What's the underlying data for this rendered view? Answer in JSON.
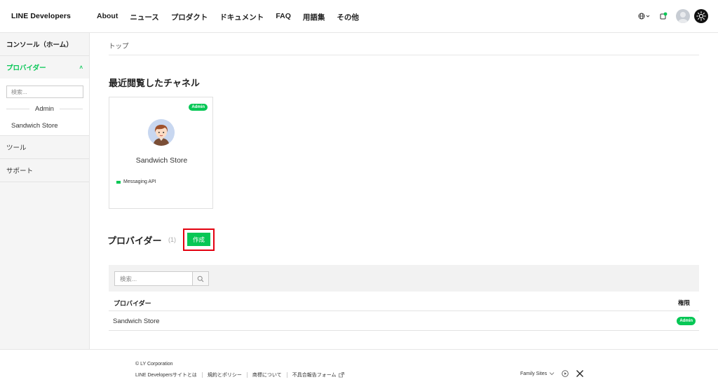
{
  "header": {
    "logo": "LINE Developers",
    "nav": [
      "About",
      "ニュース",
      "プロダクト",
      "ドキュメント",
      "FAQ",
      "用語集",
      "その他"
    ]
  },
  "sidebar": {
    "console": "コンソール（ホーム）",
    "provider": "プロバイダー",
    "provider_chevron": "˄",
    "search_placeholder": "検索...",
    "role_heading": "Admin",
    "store": "Sandwich Store",
    "tools": "ツール",
    "support": "サポート"
  },
  "main": {
    "breadcrumb": "トップ",
    "recent_title": "最近閲覧したチャネル",
    "card": {
      "badge": "Admin",
      "name": "Sandwich Store",
      "api": "Messaging API"
    },
    "providers_title": "プロバイダー",
    "providers_count": "(1)",
    "create_label": "作成",
    "table": {
      "search_placeholder": "検索...",
      "col_provider": "プロバイダー",
      "col_role": "権限",
      "rows": [
        {
          "name": "Sandwich Store",
          "role": "Admin"
        }
      ]
    }
  },
  "footer": {
    "copyright": "© LY Corporation",
    "links": [
      "LINE Developersサイトとは",
      "規約とポリシー",
      "商標について",
      "不具合報告フォーム"
    ],
    "family": "Family Sites"
  },
  "colors": {
    "accent": "#06c755",
    "highlight_frame": "#e3000f"
  }
}
